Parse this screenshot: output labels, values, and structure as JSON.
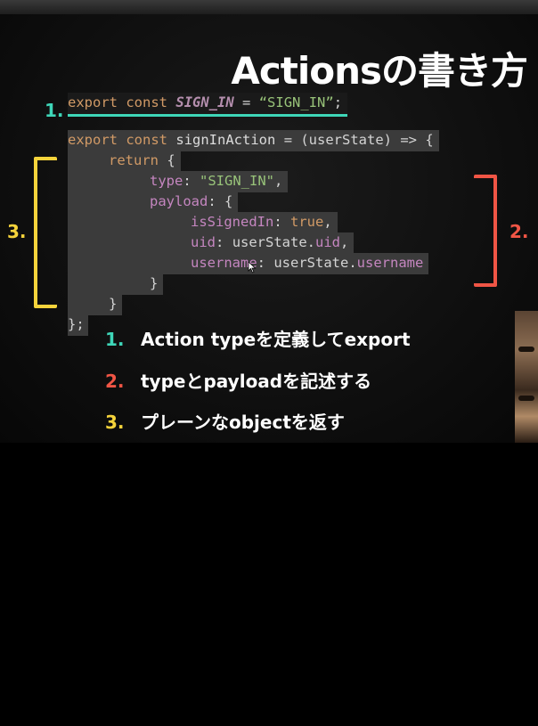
{
  "slide": {
    "title": "Actionsの書き方",
    "code": {
      "line1": {
        "kw1": "export",
        "kw2": "const",
        "name": "SIGN_IN",
        "eq": "=",
        "val": "“SIGN_IN”",
        "semi": ";"
      },
      "line2": {
        "kw1": "export",
        "kw2": "const",
        "fn": "signInAction",
        "rest": "= (userState) => {"
      },
      "line3": {
        "kw": "return",
        "brace": "{"
      },
      "line4": {
        "key": "type",
        "colon": ":",
        "val": "\"SIGN_IN\"",
        "comma": ","
      },
      "line5": {
        "key": "payload",
        "rest": ": {"
      },
      "line6": {
        "key": "isSignedIn",
        "colon": ":",
        "val": "true",
        "comma": ","
      },
      "line7": {
        "key": "uid",
        "colon": ":",
        "obj": "userState.",
        "prop": "uid",
        "comma": ","
      },
      "line8": {
        "key": "username",
        "colon": ":",
        "obj": "userState.",
        "prop": "username"
      },
      "line9": "}",
      "line10": "}",
      "line11": "};"
    },
    "labels": {
      "one": "1.",
      "two": "2.",
      "three": "3."
    },
    "list": [
      {
        "num": "1.",
        "text": "Action typeを定義してexport",
        "color": "#3ed6b8"
      },
      {
        "num": "2.",
        "text": "typeとpayloadを記述する",
        "color": "#f05545"
      },
      {
        "num": "3.",
        "text": "プレーンなobjectを返す",
        "color": "#f5d33b"
      }
    ],
    "colors": {
      "teal": "#3ed6b8",
      "red": "#f05545",
      "yellow": "#f5d33b"
    }
  }
}
